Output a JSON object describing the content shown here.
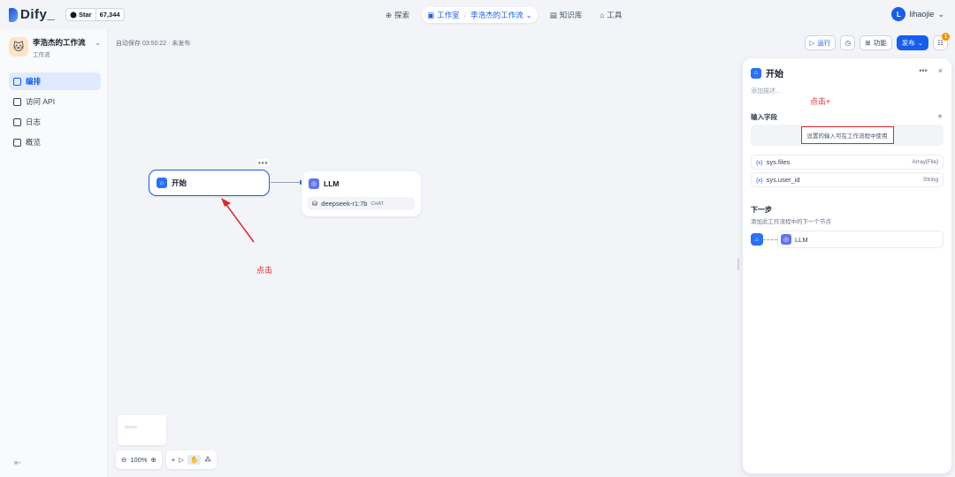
{
  "topbar": {
    "logo": "Dify_",
    "github_star": "Star",
    "github_count": "67,344",
    "nav": {
      "explore": "探索",
      "studio": "工作室",
      "current_app": "李浩杰的工作流",
      "knowledge": "知识库",
      "tools": "工具"
    },
    "user_initial": "L",
    "user_name": "lihaojie"
  },
  "sidebar": {
    "app_name": "李浩杰的工作流",
    "app_type": "工作流",
    "items": [
      {
        "label": "编排",
        "active": true
      },
      {
        "label": "访问 API"
      },
      {
        "label": "日志"
      },
      {
        "label": "概览"
      }
    ]
  },
  "canvas": {
    "autosave": "自动保存 03:50:22 · 未发布",
    "run_label": "运行",
    "features_label": "功能",
    "publish_label": "发布",
    "checklist_count": "1",
    "start_node": {
      "title": "开始",
      "more": "•••"
    },
    "llm_node": {
      "title": "LLM",
      "model": "deepseek-r1:7b",
      "mode": "CHAT"
    },
    "annotation_canvas": "点击",
    "zoom": "100%"
  },
  "panel": {
    "title": "开始",
    "more": "•••",
    "close": "×",
    "desc_placeholder": "添加描述...",
    "annotation_plus": "点击+",
    "input_fields_label": "输入字段",
    "add": "+",
    "empty_hint": "设置的输入可在工作流程中使用",
    "vars": [
      {
        "name": "sys.files",
        "type": "Array[File]"
      },
      {
        "name": "sys.user_id",
        "type": "String"
      }
    ],
    "next_title": "下一步",
    "next_desc": "添加此工作流程中的下一个节点",
    "next_node": "LLM"
  },
  "colors": {
    "accent": "#155eef",
    "annotation": "#e5242b"
  }
}
